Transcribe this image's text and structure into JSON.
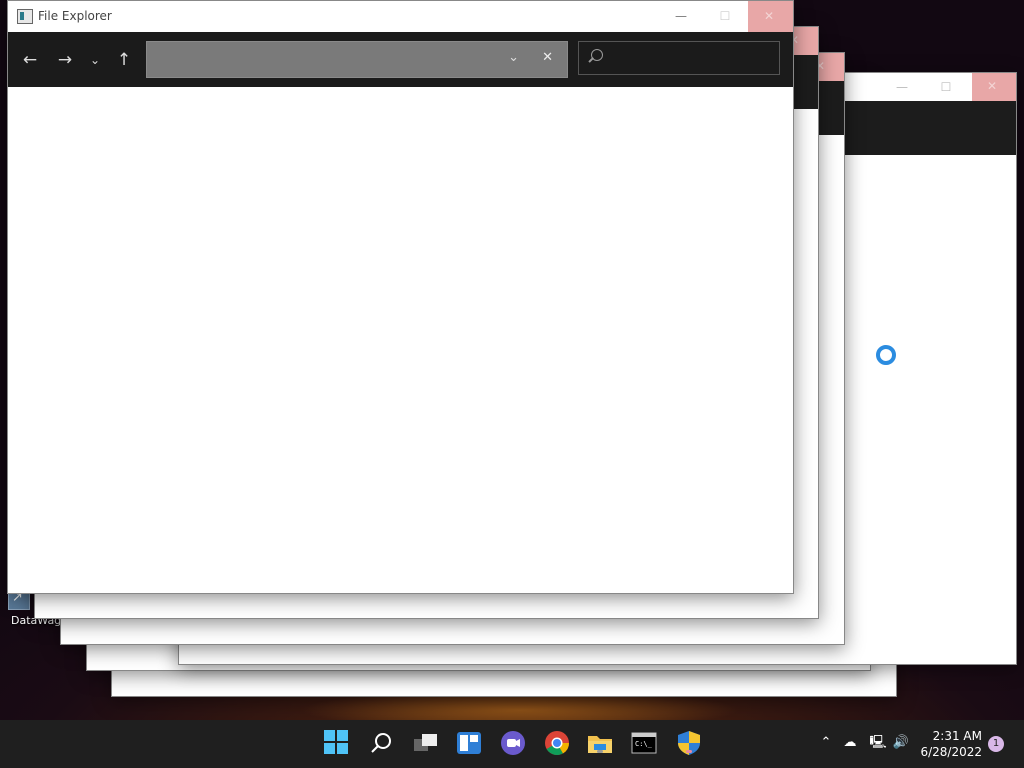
{
  "desktop": {
    "shortcut_label": "DataWag"
  },
  "window": {
    "title": "File Explorer",
    "address_value": "",
    "search_value": ""
  },
  "taskbar": {
    "apps": [
      {
        "name": "start-button",
        "icon": "windows-logo-icon"
      },
      {
        "name": "search-button",
        "icon": "search-icon"
      },
      {
        "name": "task-view-button",
        "icon": "task-view-icon"
      },
      {
        "name": "widgets-button",
        "icon": "widgets-icon"
      },
      {
        "name": "teams-chat-button",
        "icon": "chat-icon"
      },
      {
        "name": "chrome-button",
        "icon": "chrome-icon"
      },
      {
        "name": "file-explorer-button",
        "icon": "folder-icon"
      },
      {
        "name": "terminal-button",
        "icon": "terminal-icon"
      },
      {
        "name": "security-button",
        "icon": "shield-icon"
      }
    ]
  },
  "tray": {
    "time": "2:31 AM",
    "date": "6/28/2022",
    "notification_count": "1"
  },
  "colors": {
    "accent": "#2b8ce0",
    "close_hover": "#e8a7a7",
    "toolbar_dark": "#1b1b1b",
    "taskbar": "#1f1f1f"
  }
}
